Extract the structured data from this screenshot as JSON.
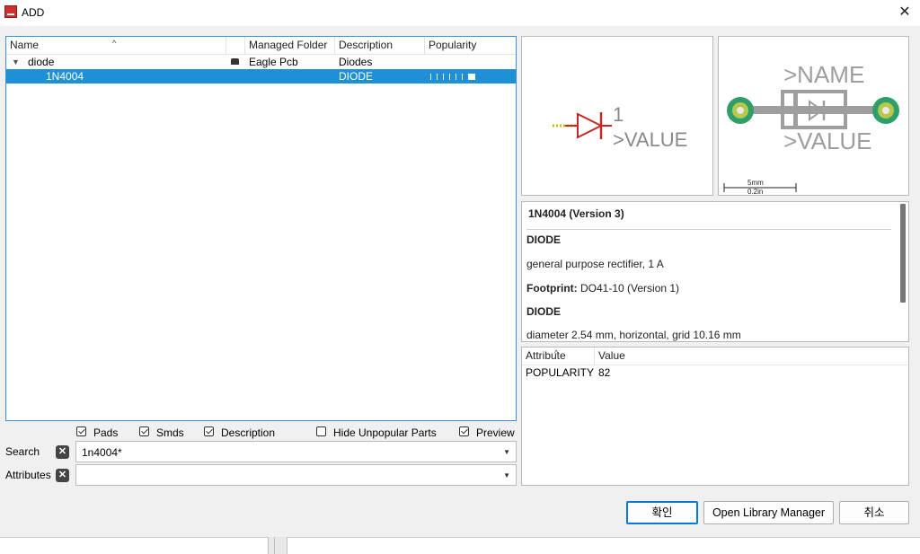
{
  "window": {
    "title": "ADD",
    "close_glyph": "✕"
  },
  "table": {
    "columns": [
      "Name",
      "Managed Folder",
      "Description",
      "Popularity"
    ],
    "rows": [
      {
        "name": "diode",
        "folder": "Eagle Pcb",
        "description": "Diodes"
      },
      {
        "name": "1N4004",
        "folder": "",
        "description": "DIODE"
      }
    ]
  },
  "filters": {
    "pads": "Pads",
    "smds": "Smds",
    "description": "Description",
    "hide_unpopular": "Hide Unpopular Parts",
    "preview": "Preview"
  },
  "search": {
    "label": "Search",
    "value": "1n4004*"
  },
  "attributes": {
    "label": "Attributes",
    "value": ""
  },
  "symbol": {
    "pin_number": "1",
    "value_text": ">VALUE"
  },
  "footprint": {
    "name_text": ">NAME",
    "value_text": ">VALUE",
    "scale_mm": "5mm",
    "scale_in": "0.2in"
  },
  "description": {
    "title": "1N4004 (Version 3)",
    "heading1": "DIODE",
    "text1": "general purpose rectifier, 1 A",
    "footprint_label": "Footprint:",
    "footprint_value": "DO41-10 (Version 1)",
    "heading2": "DIODE",
    "text2": "diameter 2.54 mm, horizontal, grid 10.16 mm"
  },
  "attr_table": {
    "columns": [
      "Attribute",
      "Value"
    ],
    "rows": [
      {
        "attribute": "POPULARITY",
        "value": "82"
      }
    ]
  },
  "buttons": {
    "ok": "확인",
    "open_library_manager": "Open Library Manager",
    "cancel": "취소"
  },
  "colors": {
    "selection": "#1e90d6",
    "symbol_red": "#c62828",
    "pad_green": "#2e9e6b"
  }
}
